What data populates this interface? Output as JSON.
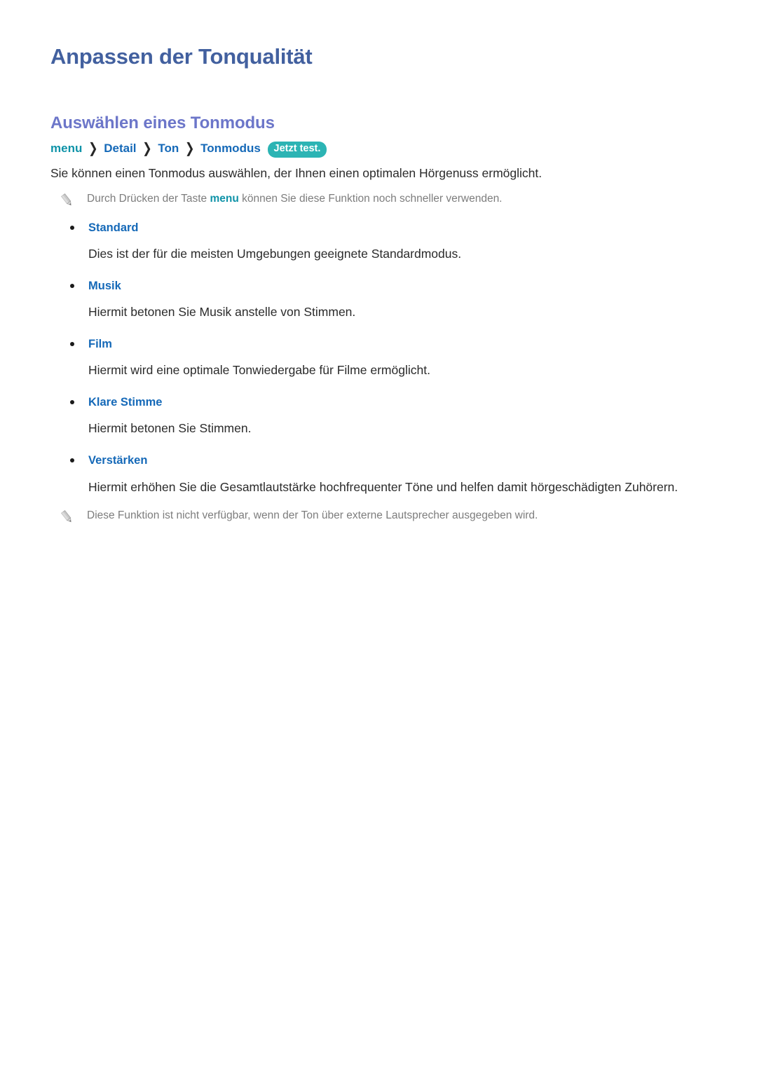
{
  "document": {
    "title": "Anpassen der Tonqualität"
  },
  "section": {
    "heading": "Auswählen eines Tonmodus",
    "breadcrumb": {
      "menu": "menu",
      "separator": "❯",
      "items": [
        "Detail",
        "Ton",
        "Tonmodus"
      ],
      "badge": "Jetzt test."
    },
    "lead": "Sie können einen Tonmodus auswählen, der Ihnen einen optimalen Hörgenuss ermöglicht.",
    "note_top": {
      "icon": "pencil-icon",
      "before": "Durch Drücken der Taste ",
      "keyword": "menu",
      "after": " können Sie diese Funktion noch schneller verwenden."
    },
    "modes": [
      {
        "name": "Standard",
        "description": "Dies ist der für die meisten Umgebungen geeignete Standardmodus."
      },
      {
        "name": "Musik",
        "description": "Hiermit betonen Sie Musik anstelle von Stimmen."
      },
      {
        "name": "Film",
        "description": "Hiermit wird eine optimale Tonwiedergabe für Filme ermöglicht."
      },
      {
        "name": "Klare Stimme",
        "description": "Hiermit betonen Sie Stimmen."
      },
      {
        "name": "Verstärken",
        "description": "Hiermit erhöhen Sie die Gesamtlautstärke hochfrequenter Töne und helfen damit hörgeschädigten Zuhörern."
      }
    ],
    "note_bottom": {
      "icon": "pencil-icon",
      "text": "Diese Funktion ist nicht verfügbar, wenn der Ton über externe Lautsprecher ausgegeben wird."
    }
  },
  "colors": {
    "title": "#42609f",
    "section_heading": "#6c76c9",
    "link_blue": "#1569b8",
    "accent_teal": "#0f93a8",
    "badge_bg": "#2cb4b4",
    "body_text": "#2b2b2b",
    "note_text": "#7d7d7d"
  }
}
